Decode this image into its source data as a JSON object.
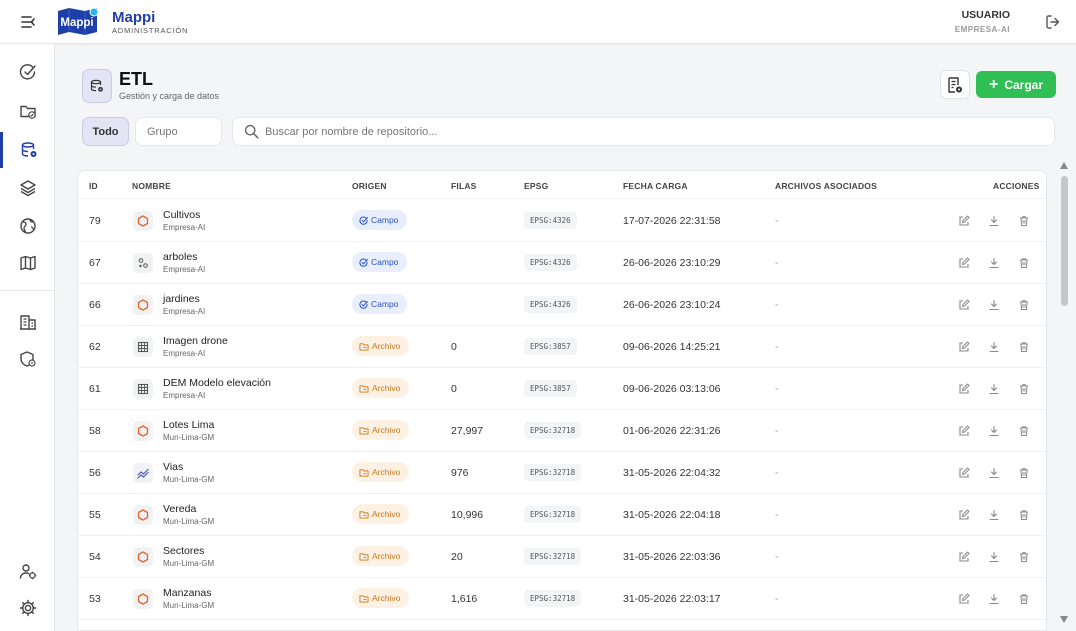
{
  "app": {
    "logo_text": "Mappi",
    "brand_name": "Mappi",
    "brand_subtitle": "ADMINISTRACIÓN"
  },
  "user": {
    "name": "USUARIO",
    "organization": "EMPRESA-AI"
  },
  "sidebar": {
    "items": [
      {
        "icon": "check-badge-icon",
        "active": false
      },
      {
        "icon": "folder-check-icon",
        "active": false
      },
      {
        "icon": "database-settings-icon",
        "active": true
      },
      {
        "icon": "layers-icon",
        "active": false
      },
      {
        "icon": "globe-icon",
        "active": false
      },
      {
        "icon": "map-icon",
        "active": false
      },
      {
        "icon": "building-icon",
        "active": false
      },
      {
        "icon": "shield-settings-icon",
        "active": false
      },
      {
        "icon": "user-settings-icon",
        "active": false
      },
      {
        "icon": "gear-icon",
        "active": false
      }
    ]
  },
  "page": {
    "title": "ETL",
    "subtitle": "Gestión y carga de datos",
    "upload_label": "Cargar"
  },
  "filters": {
    "all_label": "Todo",
    "group_placeholder": "Grupo",
    "search_placeholder": "Buscar por nombre de repositorio..."
  },
  "colors": {
    "brand": "#1e3fa8",
    "accent_green": "#2fbf55",
    "campo": "#2a52c0",
    "archivo": "#c9791a",
    "polygon": "#e8632c"
  },
  "table": {
    "headers": {
      "id": "ID",
      "name": "NOMBRE",
      "origin": "ORIGEN",
      "rows": "FILAS",
      "epsg": "EPSG",
      "date": "FECHA CARGA",
      "files": "ARCHIVOS ASOCIADOS",
      "actions": "ACCIONES"
    },
    "rows": [
      {
        "id": "79",
        "icon": "polygon-icon",
        "name": "Cultivos",
        "org": "Empresa-AI",
        "origin": "Campo",
        "origin_type": "campo",
        "rows": "",
        "epsg": "EPSG:4326",
        "date": "17-07-2026 22:31:58",
        "files": "-"
      },
      {
        "id": "67",
        "icon": "point-icon",
        "name": "arboles",
        "org": "Empresa-AI",
        "origin": "Campo",
        "origin_type": "campo",
        "rows": "",
        "epsg": "EPSG:4326",
        "date": "26-06-2026 23:10:29",
        "files": "-"
      },
      {
        "id": "66",
        "icon": "polygon-icon",
        "name": "jardines",
        "org": "Empresa-AI",
        "origin": "Campo",
        "origin_type": "campo",
        "rows": "",
        "epsg": "EPSG:4326",
        "date": "26-06-2026 23:10:24",
        "files": "-"
      },
      {
        "id": "62",
        "icon": "raster-icon",
        "name": "Imagen drone",
        "org": "Empresa-AI",
        "origin": "Archivo",
        "origin_type": "archivo",
        "rows": "0",
        "epsg": "EPSG:3857",
        "date": "09-06-2026 14:25:21",
        "files": "-"
      },
      {
        "id": "61",
        "icon": "raster-icon",
        "name": "DEM Modelo elevación",
        "org": "Empresa-AI",
        "origin": "Archivo",
        "origin_type": "archivo",
        "rows": "0",
        "epsg": "EPSG:3857",
        "date": "09-06-2026 03:13:06",
        "files": "-"
      },
      {
        "id": "58",
        "icon": "polygon-icon",
        "name": "Lotes Lima",
        "org": "Mun-Lima-GM",
        "origin": "Archivo",
        "origin_type": "archivo",
        "rows": "27,997",
        "epsg": "EPSG:32718",
        "date": "01-06-2026 22:31:26",
        "files": "-"
      },
      {
        "id": "56",
        "icon": "line-icon",
        "name": "Vias",
        "org": "Mun-Lima-GM",
        "origin": "Archivo",
        "origin_type": "archivo",
        "rows": "976",
        "epsg": "EPSG:32718",
        "date": "31-05-2026 22:04:32",
        "files": "-"
      },
      {
        "id": "55",
        "icon": "polygon-icon",
        "name": "Vereda",
        "org": "Mun-Lima-GM",
        "origin": "Archivo",
        "origin_type": "archivo",
        "rows": "10,996",
        "epsg": "EPSG:32718",
        "date": "31-05-2026 22:04:18",
        "files": "-"
      },
      {
        "id": "54",
        "icon": "polygon-icon",
        "name": "Sectores",
        "org": "Mun-Lima-GM",
        "origin": "Archivo",
        "origin_type": "archivo",
        "rows": "20",
        "epsg": "EPSG:32718",
        "date": "31-05-2026 22:03:36",
        "files": "-"
      },
      {
        "id": "53",
        "icon": "polygon-icon",
        "name": "Manzanas",
        "org": "Mun-Lima-GM",
        "origin": "Archivo",
        "origin_type": "archivo",
        "rows": "1,616",
        "epsg": "EPSG:32718",
        "date": "31-05-2026 22:03:17",
        "files": "-"
      }
    ]
  }
}
